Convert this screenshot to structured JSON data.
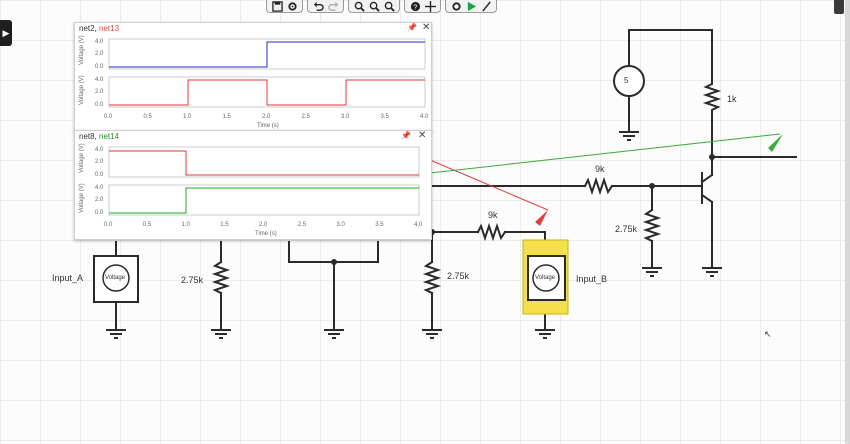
{
  "toolbar": {
    "groups": [
      {
        "name": "file",
        "items": [
          "save-icon",
          "settings-icon"
        ]
      },
      {
        "name": "history",
        "items": [
          "undo-icon",
          "redo-icon"
        ]
      },
      {
        "name": "zoom",
        "items": [
          "zoom-in-icon",
          "zoom-out-icon",
          "zoom-fit-icon"
        ]
      },
      {
        "name": "help",
        "items": [
          "help-icon",
          "center-icon"
        ]
      },
      {
        "name": "sim",
        "items": [
          "sim-settings-icon",
          "run-icon",
          "probe-icon"
        ]
      }
    ]
  },
  "sidebar_toggle": "▶",
  "scope1": {
    "title_a": "net2",
    "title_b": "net13",
    "top_ylabel": "Voltage (V)",
    "bottom_ylabel": "Voltage (V)",
    "xlabel": "Time (s)",
    "y_ticks": [
      "4.0",
      "2.0",
      "0.0"
    ],
    "x_ticks": [
      "0.0",
      "0.5",
      "1.0",
      "1.5",
      "2.0",
      "2.5",
      "3.0",
      "3.5",
      "4.0"
    ]
  },
  "scope2": {
    "title_a": "net8",
    "title_b": "net14",
    "top_ylabel": "Voltage (V)",
    "bottom_ylabel": "Voltage (V)",
    "xlabel": "Time (s)",
    "y_ticks": [
      "4.0",
      "2.0",
      "0.0"
    ],
    "x_ticks": [
      "0.0",
      "0.5",
      "1.0",
      "1.5",
      "2.0",
      "2.5",
      "3.0",
      "3.5",
      "4.0"
    ]
  },
  "components": {
    "input_a_label": "Input_A",
    "input_b_label": "Input_B",
    "voltage_text": "Voltage",
    "source_value": "5",
    "r_1k": "1k",
    "r_9k_top": "9k",
    "r_9k_mid": "9k",
    "r_275k_right": "2.75k",
    "r_275k_mid": "2.75k",
    "r_275k_left": "2.75k"
  },
  "colors": {
    "wire": "#2b2b2b",
    "trace_blue": "#2a2acb",
    "trace_red": "#e23a3a",
    "trace_green": "#22aa22",
    "probe_red": "#e04040",
    "probe_green": "#3aaa3a",
    "highlight": "#f3e04a"
  }
}
